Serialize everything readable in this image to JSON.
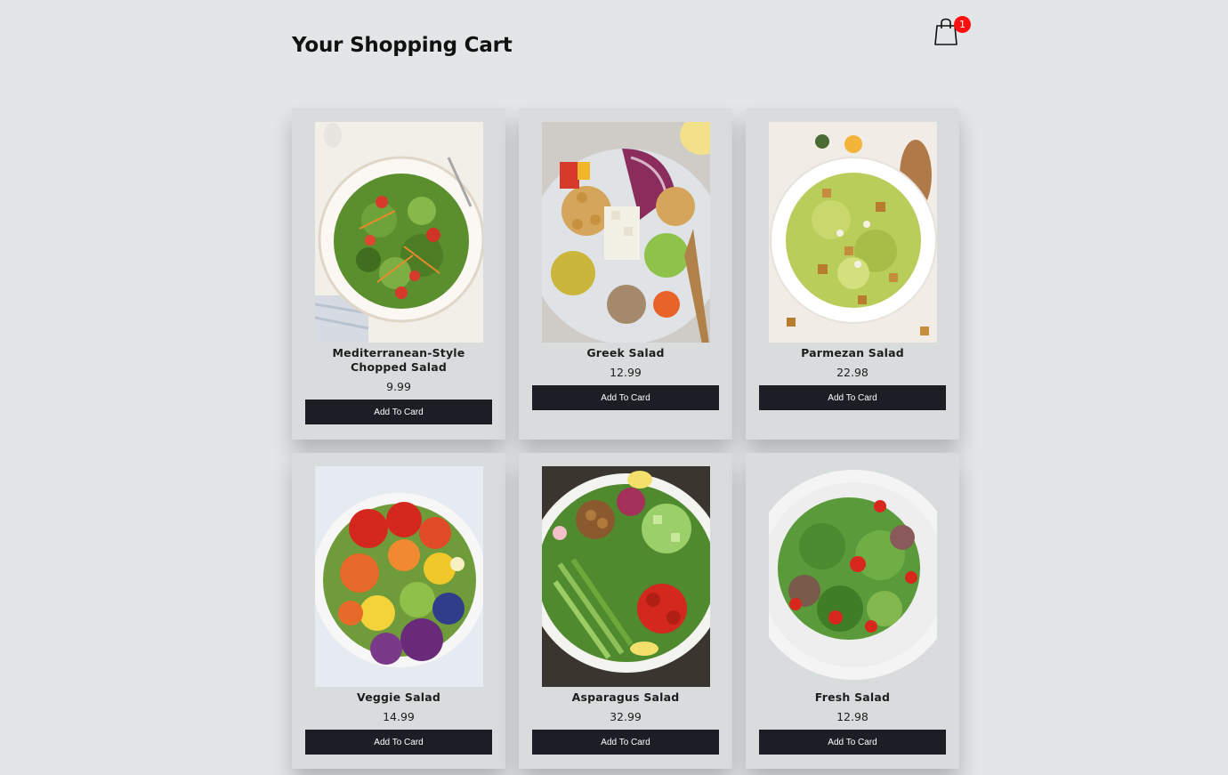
{
  "header": {
    "title": "Your Shopping Cart",
    "cart_icon": "shopping-bag-icon",
    "cart_count": "1",
    "badge_color": "#ff1010"
  },
  "products": [
    {
      "name": "Mediterranean-Style Chopped Salad",
      "price": "9.99",
      "button_label": "Add To Card"
    },
    {
      "name": "Greek Salad",
      "price": "12.99",
      "button_label": "Add To Card"
    },
    {
      "name": "Parmezan Salad",
      "price": "22.98",
      "button_label": "Add To Card"
    },
    {
      "name": "Veggie Salad",
      "price": "14.99",
      "button_label": "Add To Card"
    },
    {
      "name": "Asparagus Salad",
      "price": "32.99",
      "button_label": "Add To Card"
    },
    {
      "name": "Fresh Salad",
      "price": "12.98",
      "button_label": "Add To Card"
    }
  ],
  "colors": {
    "background": "#e3e6e7",
    "card": "#d9dcdd",
    "button": "#1b1f25"
  }
}
